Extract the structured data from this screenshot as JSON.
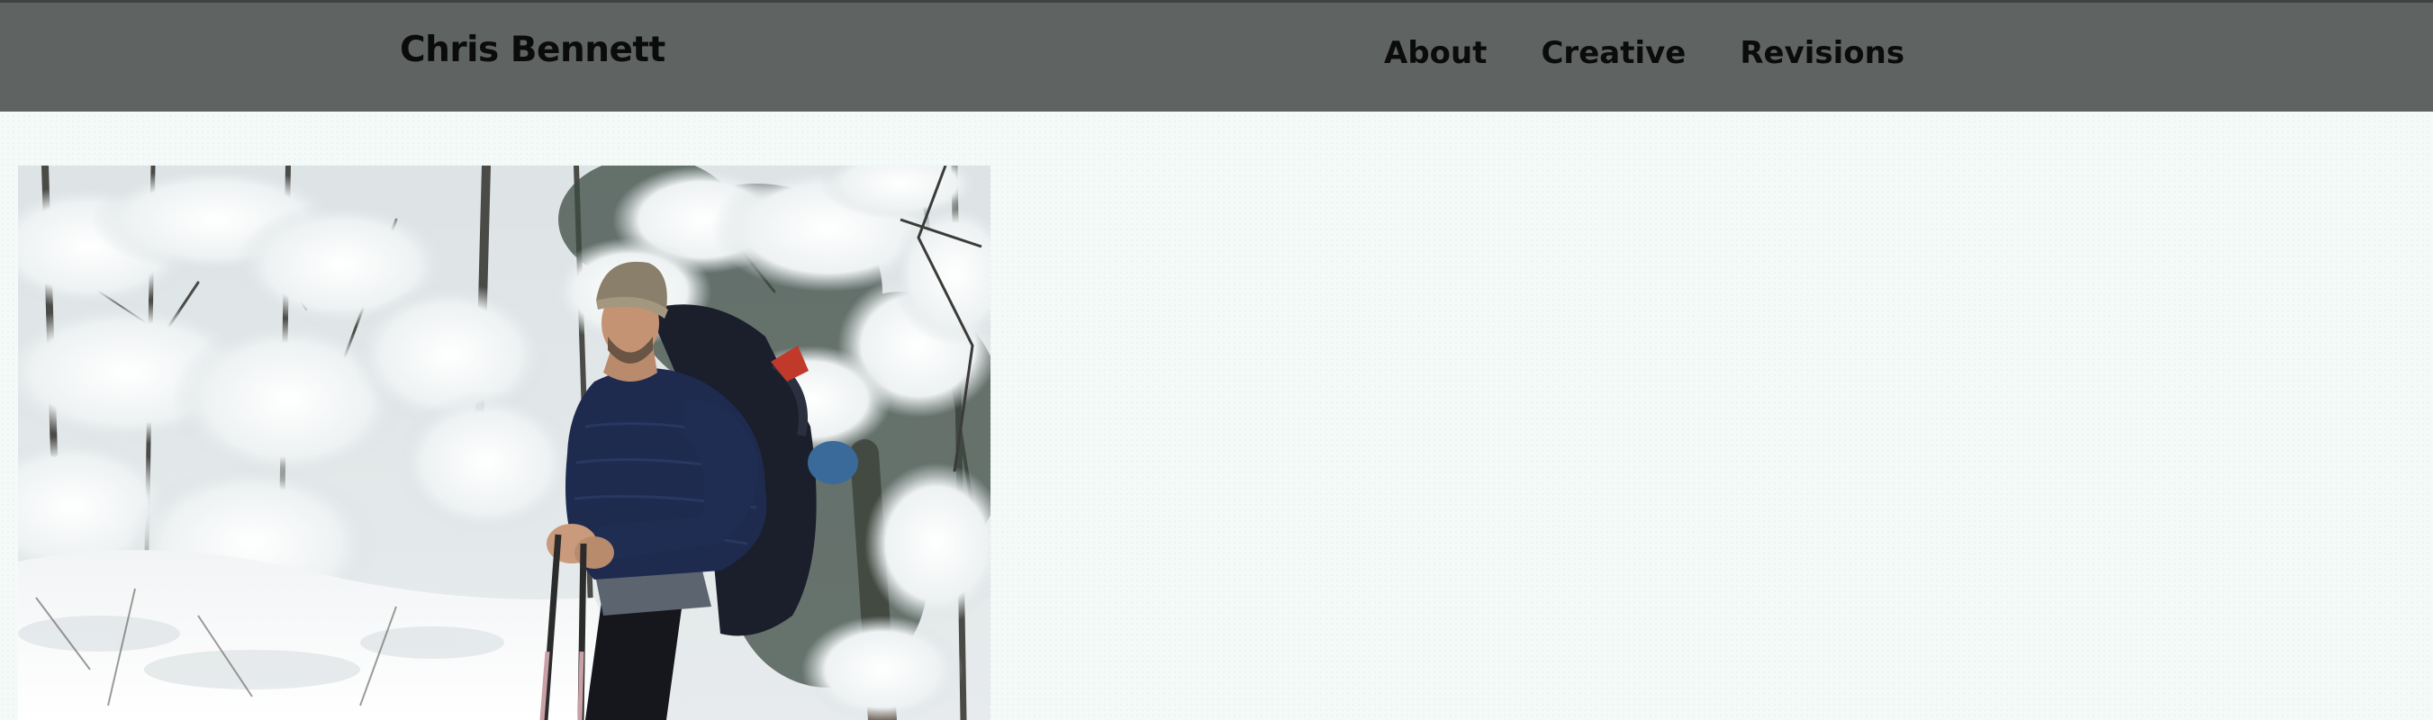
{
  "site": {
    "brand": "Chris Bennett"
  },
  "nav": {
    "items": [
      {
        "label": "About"
      },
      {
        "label": "Creative"
      },
      {
        "label": "Revisions"
      }
    ]
  },
  "colors": {
    "header_bg": "#5f6463",
    "page_bg": "#f4faf8",
    "text": "#0b0b0b"
  },
  "hero_image": {
    "description_icon": "photo"
  }
}
